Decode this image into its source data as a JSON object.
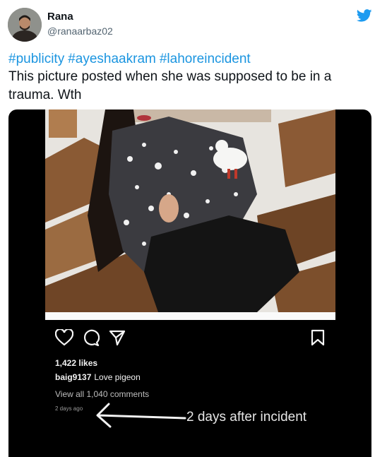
{
  "tweet": {
    "author_name": "Rana",
    "author_handle": "@ranaarbaz02",
    "hashtags": [
      "#publicity",
      "#ayeshaakram",
      "#lahoreincident"
    ],
    "text": "This picture posted when she was supposed to be in a trauma. Wth"
  },
  "instagram_post": {
    "likes": "1,422 likes",
    "caption_user": "baig9137",
    "caption_text": "Love pigeon",
    "view_all_comments": "View all 1,040 comments",
    "time_ago": "2 days ago"
  },
  "annotation": {
    "text": "2 days after incident"
  },
  "icons": {
    "brand": "twitter-bird-icon",
    "like": "heart-icon",
    "comment": "comment-bubble-icon",
    "share": "send-icon",
    "save": "bookmark-icon"
  },
  "colors": {
    "hashtag": "#1b95e0",
    "twitter_brand": "#1d9bf0",
    "media_background": "#000000"
  }
}
